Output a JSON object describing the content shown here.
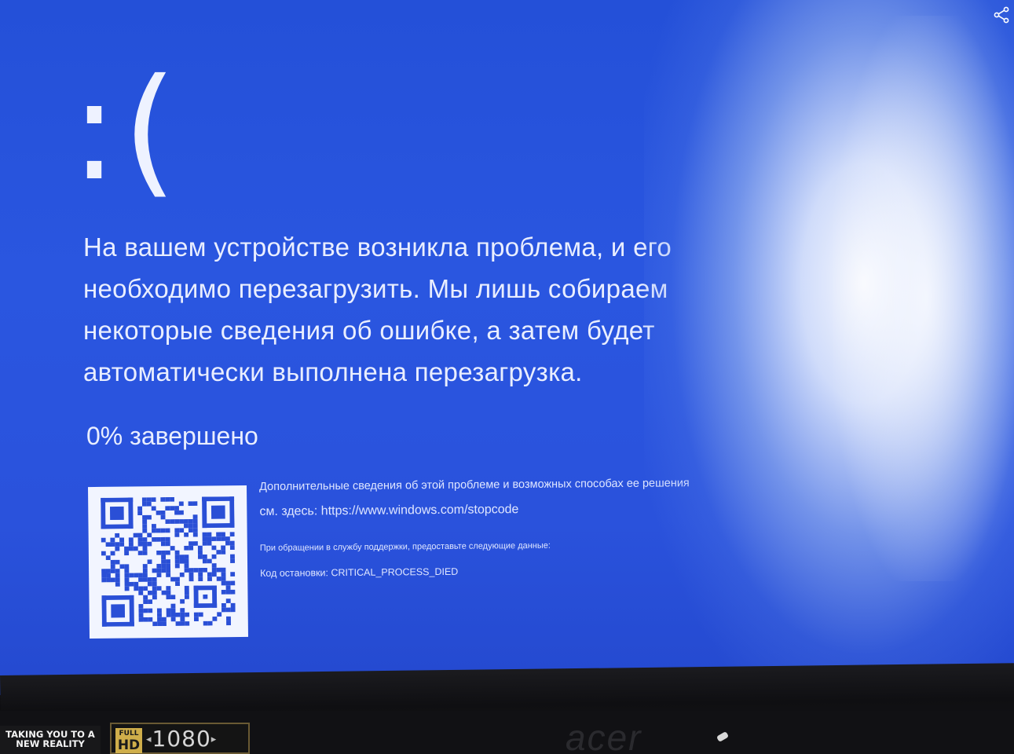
{
  "bsod": {
    "face": ":(",
    "message_lines": [
      "На вашем устройстве возникла проблема, и его",
      "необходимо перезагрузить. Мы лишь собираем",
      "некоторые сведения об ошибке, а затем будет",
      "автоматически выполнена перезагрузка."
    ],
    "progress_text": "0% завершено",
    "more_info_line1": "Дополнительные сведения об этой проблеме и возможных способах ее решения",
    "more_info_line2_prefix": "см. здесь: ",
    "stopcode_url": "https://www.windows.com/stopcode",
    "support_text": "При обращении в службу поддержки, предоставьте следующие данные:",
    "stop_code_label": "Код остановки: ",
    "stop_code": "CRITICAL_PROCESS_DIED",
    "qr_code": "qr-code-stopcode"
  },
  "overlay": {
    "share_icon": "share-icon"
  },
  "monitor": {
    "brand": "acer",
    "sticker_taking_line1": "TAKING YOU TO A",
    "sticker_taking_line2": "NEW REALITY",
    "sticker_full": "FULL",
    "sticker_hd": "HD",
    "sticker_resolution": "1080"
  },
  "colors": {
    "bsod_blue": "#2a56e0",
    "text": "#e9eeff",
    "bezel": "#111114"
  }
}
